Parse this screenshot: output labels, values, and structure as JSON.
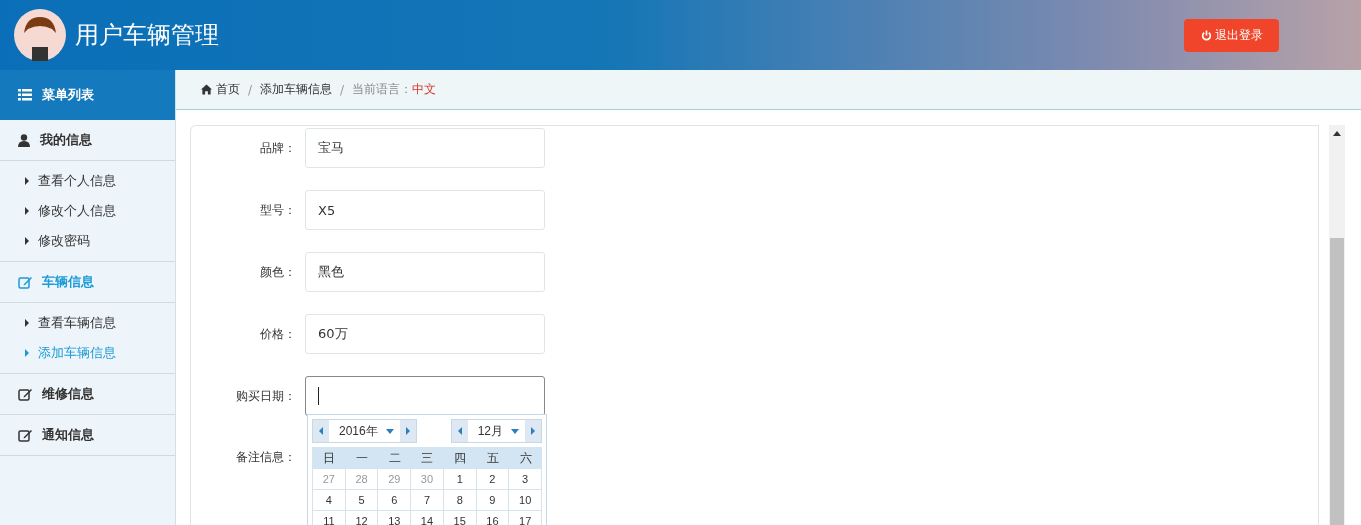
{
  "header": {
    "title": "用户车辆管理",
    "logout": "退出登录"
  },
  "sidebar": {
    "title": "菜单列表",
    "groups": [
      {
        "label": "我的信息",
        "kind": "user",
        "selected": false,
        "items": [
          {
            "label": "查看个人信息",
            "selected": false
          },
          {
            "label": "修改个人信息",
            "selected": false
          },
          {
            "label": "修改密码",
            "selected": false
          }
        ]
      },
      {
        "label": "车辆信息",
        "kind": "edit",
        "selected": true,
        "items": [
          {
            "label": "查看车辆信息",
            "selected": false
          },
          {
            "label": "添加车辆信息",
            "selected": true
          }
        ]
      },
      {
        "label": "维修信息",
        "kind": "edit",
        "selected": false
      },
      {
        "label": "通知信息",
        "kind": "edit",
        "selected": false
      }
    ]
  },
  "breadcrumb": [
    {
      "kind": "home",
      "label": "首页"
    },
    {
      "kind": "sep",
      "label": "/"
    },
    {
      "kind": "link",
      "label": "添加车辆信息"
    },
    {
      "kind": "sep",
      "label": "/"
    },
    {
      "kind": "lang",
      "label": "当前语言：",
      "value": "中文"
    }
  ],
  "form": {
    "fields": [
      {
        "kind": "text",
        "label": "品牌：",
        "value": "宝马",
        "focused": false
      },
      {
        "kind": "text",
        "label": "型号：",
        "value": "X5",
        "focused": false
      },
      {
        "kind": "text",
        "label": "颜色：",
        "value": "黑色",
        "focused": false
      },
      {
        "kind": "text",
        "label": "价格：",
        "value": "60万",
        "focused": false
      },
      {
        "kind": "text",
        "label": "购买日期：",
        "focused": true
      },
      {
        "kind": "label",
        "label": "备注信息："
      }
    ]
  },
  "datepicker": {
    "year": "2016年",
    "month": "12月",
    "weekdays": [
      "日",
      "一",
      "二",
      "三",
      "四",
      "五",
      "六"
    ],
    "weeks": [
      [
        {
          "day": "27",
          "muted": true
        },
        {
          "day": "28",
          "muted": true
        },
        {
          "day": "29",
          "muted": true
        },
        {
          "day": "30",
          "muted": true
        },
        {
          "day": "1",
          "muted": false
        },
        {
          "day": "2",
          "muted": false
        },
        {
          "day": "3",
          "muted": false
        }
      ],
      [
        {
          "day": "4",
          "muted": false
        },
        {
          "day": "5",
          "muted": false
        },
        {
          "day": "6",
          "muted": false
        },
        {
          "day": "7",
          "muted": false
        },
        {
          "day": "8",
          "muted": false
        },
        {
          "day": "9",
          "muted": false
        },
        {
          "day": "10",
          "muted": false
        }
      ],
      [
        {
          "day": "11",
          "muted": false
        },
        {
          "day": "12",
          "muted": false
        },
        {
          "day": "13",
          "muted": false
        },
        {
          "day": "14",
          "muted": false
        },
        {
          "day": "15",
          "muted": false
        },
        {
          "day": "16",
          "muted": false
        },
        {
          "day": "17",
          "muted": false
        }
      ]
    ]
  }
}
